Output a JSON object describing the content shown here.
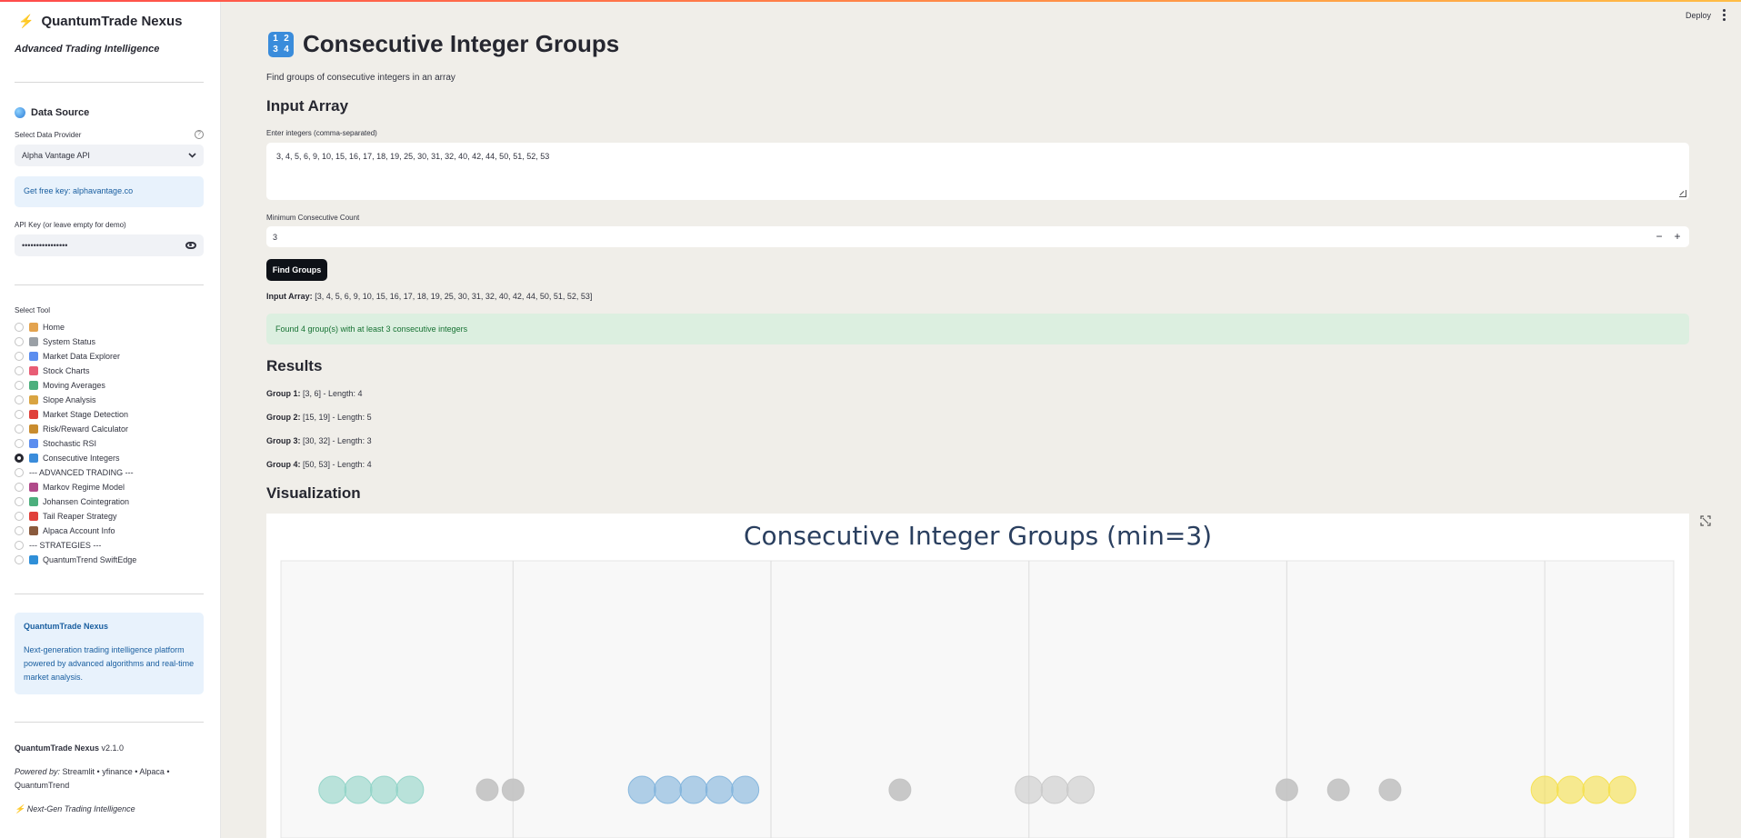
{
  "sidebar": {
    "brand": "QuantumTrade Nexus",
    "tagline": "Advanced Trading Intelligence",
    "data_source_title": "Data Source",
    "provider_label": "Select Data Provider",
    "provider_value": "Alpha Vantage API",
    "free_key_text": "Get free key: alphavantage.co",
    "api_key_label": "API Key (or leave empty for demo)",
    "api_key_value": "••••••••••••••••",
    "tool_label": "Select Tool",
    "tools": [
      {
        "label": "Home",
        "icon": "house-icon",
        "color": "#e3a34f",
        "selected": false
      },
      {
        "label": "System Status",
        "icon": "wrench-icon",
        "color": "#9aa0a6",
        "selected": false
      },
      {
        "label": "Market Data Explorer",
        "icon": "bar-chart-icon",
        "color": "#5b8def",
        "selected": false
      },
      {
        "label": "Stock Charts",
        "icon": "chart-down-icon",
        "color": "#e85d75",
        "selected": false
      },
      {
        "label": "Moving Averages",
        "icon": "chart-up-icon",
        "color": "#4caf7d",
        "selected": false
      },
      {
        "label": "Slope Analysis",
        "icon": "triangle-ruler-icon",
        "color": "#d9a441",
        "selected": false
      },
      {
        "label": "Market Stage Detection",
        "icon": "target-icon",
        "color": "#e0403a",
        "selected": false
      },
      {
        "label": "Risk/Reward Calculator",
        "icon": "scales-icon",
        "color": "#c98c2e",
        "selected": false
      },
      {
        "label": "Stochastic RSI",
        "icon": "bar-chart-icon",
        "color": "#5b8def",
        "selected": false
      },
      {
        "label": "Consecutive Integers",
        "icon": "numbers-icon",
        "color": "#3a8cdb",
        "selected": true
      },
      {
        "label": "--- ADVANCED TRADING ---",
        "icon": "",
        "color": "",
        "selected": false
      },
      {
        "label": "Markov Regime Model",
        "icon": "slot-machine-icon",
        "color": "#b04a8a",
        "selected": false
      },
      {
        "label": "Johansen Cointegration",
        "icon": "chart-up-icon",
        "color": "#4caf7d",
        "selected": false
      },
      {
        "label": "Tail Reaper Strategy",
        "icon": "target-icon",
        "color": "#e0403a",
        "selected": false
      },
      {
        "label": "Alpaca Account Info",
        "icon": "briefcase-icon",
        "color": "#8a5a3c",
        "selected": false
      },
      {
        "label": "--- STRATEGIES ---",
        "icon": "",
        "color": "",
        "selected": false
      },
      {
        "label": "QuantumTrend SwiftEdge",
        "icon": "wave-icon",
        "color": "#2f8fd8",
        "selected": false
      }
    ],
    "about_title": "QuantumTrade Nexus",
    "about_desc": "Next-generation trading intelligence platform powered by advanced algorithms and real-time market analysis.",
    "footer_name": "QuantumTrade Nexus",
    "footer_version": "v2.1.0",
    "footer_powered_label": "Powered by:",
    "footer_powered": "Streamlit • yfinance • Alpaca • QuantumTrend",
    "footer_tagline": "Next-Gen Trading Intelligence"
  },
  "header": {
    "deploy": "Deploy"
  },
  "main": {
    "title": "Consecutive Integer Groups",
    "title_icon": "1 2 3 4",
    "subtitle": "Find groups of consecutive integers in an array",
    "input_heading": "Input Array",
    "textarea_label": "Enter integers (comma-separated)",
    "textarea_value": "3, 4, 5, 6, 9, 10, 15, 16, 17, 18, 19, 25, 30, 31, 32, 40, 42, 44, 50, 51, 52, 53",
    "min_label": "Minimum Consecutive Count",
    "min_value": "3",
    "minus": "−",
    "plus": "+",
    "button": "Find Groups",
    "input_array_label": "Input Array:",
    "input_array_value": "[3, 4, 5, 6, 9, 10, 15, 16, 17, 18, 19, 25, 30, 31, 32, 40, 42, 44, 50, 51, 52, 53]",
    "success": "Found 4 group(s) with at least 3 consecutive integers",
    "results_heading": "Results",
    "groups": [
      {
        "label": "Group 1:",
        "text": "[3, 6] - Length: 4"
      },
      {
        "label": "Group 2:",
        "text": "[15, 19] - Length: 5"
      },
      {
        "label": "Group 3:",
        "text": "[30, 32] - Length: 3"
      },
      {
        "label": "Group 4:",
        "text": "[50, 53] - Length: 4"
      }
    ],
    "viz_heading": "Visualization"
  },
  "chart_data": {
    "type": "scatter",
    "title": "Consecutive Integer Groups (min=3)",
    "xlim": [
      1,
      55
    ],
    "grid": true,
    "colors": {
      "group1": "#8fd3c7",
      "group2": "#7fb2dc",
      "group3": "#c9c9c9",
      "group4": "#f5e04a",
      "ungrouped": "#c2c2c2"
    },
    "series": [
      {
        "group": "group1",
        "x": [
          3,
          4,
          5,
          6
        ],
        "y": [
          0,
          0,
          0,
          0
        ]
      },
      {
        "group": "ungrouped",
        "x": [
          9,
          10
        ],
        "y": [
          0,
          0
        ]
      },
      {
        "group": "group2",
        "x": [
          15,
          16,
          17,
          18,
          19
        ],
        "y": [
          0,
          0,
          0,
          0,
          0
        ]
      },
      {
        "group": "ungrouped",
        "x": [
          25
        ],
        "y": [
          0
        ]
      },
      {
        "group": "group3",
        "x": [
          30,
          31,
          32
        ],
        "y": [
          0,
          0,
          0
        ]
      },
      {
        "group": "ungrouped",
        "x": [
          40,
          42,
          44
        ],
        "y": [
          0,
          0,
          0
        ]
      },
      {
        "group": "group4",
        "x": [
          50,
          51,
          52,
          53
        ],
        "y": [
          0,
          0,
          0,
          0
        ]
      }
    ],
    "vgrid_x": [
      10,
      20,
      30,
      40,
      50
    ]
  }
}
